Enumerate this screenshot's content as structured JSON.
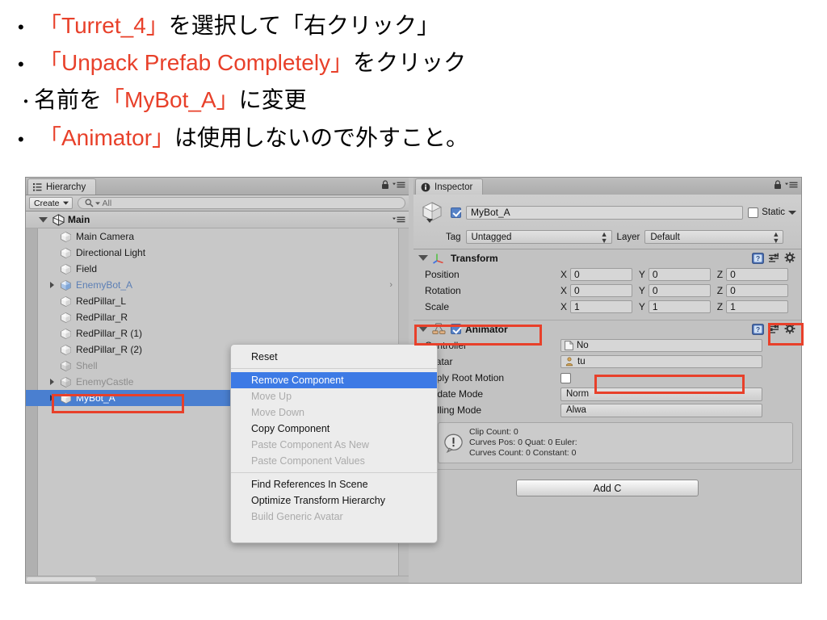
{
  "slide": {
    "lines": [
      {
        "bullet": "•",
        "tight": false,
        "parts": [
          {
            "t": "「Turret_4」",
            "c": "red"
          },
          {
            "t": "を選択して「右クリック」",
            "c": "blk"
          }
        ]
      },
      {
        "bullet": "•",
        "tight": false,
        "parts": [
          {
            "t": "「Unpack Prefab Completely」",
            "c": "red"
          },
          {
            "t": " をクリック",
            "c": "blk"
          }
        ]
      },
      {
        "bullet": "・",
        "tight": true,
        "parts": [
          {
            "t": "名前を",
            "c": "blk"
          },
          {
            "t": "「MyBot_A」",
            "c": "red"
          },
          {
            "t": " に変更",
            "c": "blk"
          }
        ]
      },
      {
        "bullet": "•",
        "tight": false,
        "parts": [
          {
            "t": "「Animator」",
            "c": "red"
          },
          {
            "t": " は使用しないので外すこと。",
            "c": "blk"
          }
        ]
      }
    ],
    "accent_color": "#e8402a"
  },
  "hierarchy": {
    "tab_label": "Hierarchy",
    "create_label": "Create",
    "search_placeholder": "All",
    "root_label": "Main",
    "items": [
      {
        "label": "Main Camera",
        "state": "normal",
        "expandable": false,
        "child_arrow": false
      },
      {
        "label": "Directional Light",
        "state": "normal",
        "expandable": false,
        "child_arrow": false
      },
      {
        "label": "Field",
        "state": "normal",
        "expandable": false,
        "child_arrow": false
      },
      {
        "label": "EnemyBot_A",
        "state": "prefab",
        "expandable": true,
        "child_arrow": true
      },
      {
        "label": "RedPillar_L",
        "state": "normal",
        "expandable": false,
        "child_arrow": false
      },
      {
        "label": "RedPillar_R",
        "state": "normal",
        "expandable": false,
        "child_arrow": false
      },
      {
        "label": "RedPillar_R (1)",
        "state": "normal",
        "expandable": false,
        "child_arrow": false
      },
      {
        "label": "RedPillar_R (2)",
        "state": "normal",
        "expandable": false,
        "child_arrow": false
      },
      {
        "label": "Shell",
        "state": "dim",
        "expandable": false,
        "child_arrow": false
      },
      {
        "label": "EnemyCastle",
        "state": "dim",
        "expandable": true,
        "child_arrow": false
      },
      {
        "label": "MyBot_A",
        "state": "selected",
        "expandable": true,
        "child_arrow": false
      }
    ],
    "selection_color": "#4a7fd0"
  },
  "inspector": {
    "tab_label": "Inspector",
    "object_name": "MyBot_A",
    "object_enabled": true,
    "static_label": "Static",
    "static_checked": false,
    "tag_label": "Tag",
    "tag_value": "Untagged",
    "layer_label": "Layer",
    "layer_value": "Default",
    "transform": {
      "title": "Transform",
      "rows": [
        {
          "label": "Position",
          "x": "0",
          "y": "0",
          "z": "0"
        },
        {
          "label": "Rotation",
          "x": "0",
          "y": "0",
          "z": "0"
        },
        {
          "label": "Scale",
          "x": "1",
          "y": "1",
          "z": "1"
        }
      ],
      "axis_labels": [
        "X",
        "Y",
        "Z"
      ]
    },
    "animator": {
      "title": "Animator",
      "enabled": true,
      "controller_label": "Controller",
      "controller_value": "No",
      "avatar_label": "Avatar",
      "avatar_value": "tu",
      "apply_root_motion_label": "Apply Root Motion",
      "apply_root_motion_checked": false,
      "update_mode_label": "Update Mode",
      "update_mode_value": "Norm",
      "culling_mode_label": "Culling Mode",
      "culling_mode_value": "Alwa",
      "info_lines": [
        "Clip Count: 0",
        "Curves Pos: 0 Quat: 0 Euler:",
        "Curves Count: 0 Constant: 0"
      ]
    },
    "add_component_label": "Add C"
  },
  "context_menu": {
    "items": [
      {
        "label": "Reset",
        "state": "normal"
      },
      {
        "label": "__SEP__",
        "state": "separator"
      },
      {
        "label": "Remove Component",
        "state": "highlighted"
      },
      {
        "label": "Move Up",
        "state": "disabled"
      },
      {
        "label": "Move Down",
        "state": "disabled"
      },
      {
        "label": "Copy Component",
        "state": "normal"
      },
      {
        "label": "Paste Component As New",
        "state": "disabled"
      },
      {
        "label": "Paste Component Values",
        "state": "disabled"
      },
      {
        "label": "__SEP__",
        "state": "separator"
      },
      {
        "label": "Find References In Scene",
        "state": "normal"
      },
      {
        "label": "Optimize Transform Hierarchy",
        "state": "normal"
      },
      {
        "label": "Build Generic Avatar",
        "state": "disabled"
      }
    ],
    "highlight_color": "#3d7ae5"
  },
  "annotations": {
    "color": "#e8402a",
    "boxes": [
      {
        "name": "hierarchy-mybot-a-highlight"
      },
      {
        "name": "animator-header-highlight"
      },
      {
        "name": "animator-gear-highlight"
      },
      {
        "name": "remove-component-highlight"
      }
    ]
  }
}
